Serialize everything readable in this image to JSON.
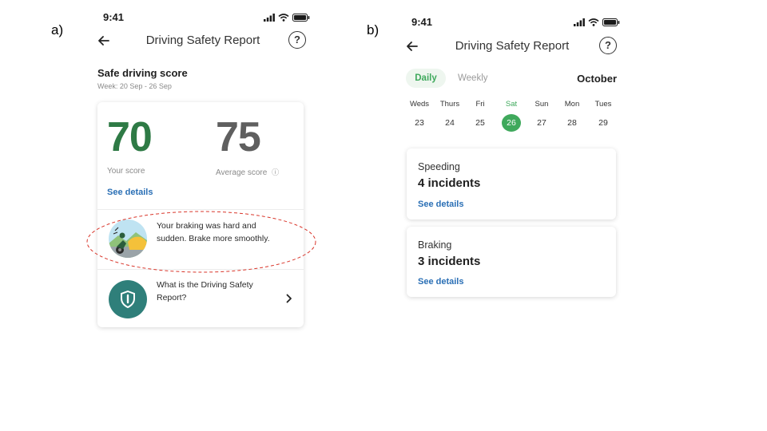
{
  "labels": {
    "a": "a)",
    "b": "b)"
  },
  "phone_a": {
    "status_time": "9:41",
    "nav_title": "Driving Safety Report",
    "help_glyph": "?",
    "section_title": "Safe driving score",
    "week": "Week: 20 Sep - 26 Sep",
    "your_score": "70",
    "your_score_label": "Your score",
    "average_score": "75",
    "average_score_label": "Average score",
    "info_glyph": "ⓘ",
    "see_details": "See details",
    "tip_text": "Your braking was hard and sudden. Brake more smoothly.",
    "faq_text": "What is the Driving Safety Report?",
    "colors": {
      "score_green": "#2e7a45",
      "score_grey": "#5f5f5f",
      "badge_teal": "#2f7f7a",
      "highlight_red": "#d9362b"
    }
  },
  "phone_b": {
    "status_time": "9:41",
    "nav_title": "Driving Safety Report",
    "help_glyph": "?",
    "tabs": [
      {
        "label": "Daily",
        "active": true
      },
      {
        "label": "Weekly",
        "active": false
      }
    ],
    "month": "October",
    "days": [
      {
        "name": "Weds",
        "num": "23",
        "selected": false
      },
      {
        "name": "Thurs",
        "num": "24",
        "selected": false
      },
      {
        "name": "Fri",
        "num": "25",
        "selected": false
      },
      {
        "name": "Sat",
        "num": "26",
        "selected": true
      },
      {
        "name": "Sun",
        "num": "27",
        "selected": false
      },
      {
        "name": "Mon",
        "num": "28",
        "selected": false
      },
      {
        "name": "Tues",
        "num": "29",
        "selected": false
      }
    ],
    "incidents": [
      {
        "type": "Speeding",
        "count": "4 incidents",
        "link": "See details"
      },
      {
        "type": "Braking",
        "count": "3 incidents",
        "link": "See details"
      }
    ],
    "colors": {
      "accent_green": "#3fa95c",
      "tab_bg": "#eef6ef"
    }
  }
}
